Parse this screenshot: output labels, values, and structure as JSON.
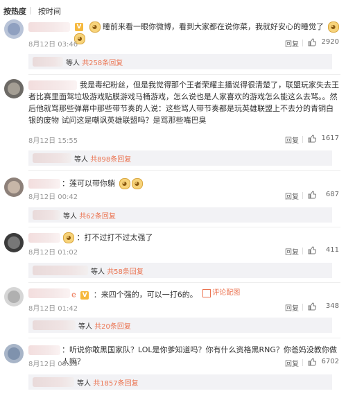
{
  "sort": {
    "hot": "按热度",
    "time": "按时间"
  },
  "comments": [
    {
      "text": "睡前来看一眼你微博，看到大家都在说你菜，我就好安心的睡觉了",
      "time": "8月12日 03:46",
      "reply_label": "回复",
      "likes": "2920",
      "sub": {
        "label": "等人",
        "link": "共258条回复"
      }
    },
    {
      "text": "我是毒纪粉丝，但是我觉得那个王者荣耀主播说得很清楚了，联盟玩家失去王者比赛里面驾垃圾游戏贴膜游戏马桶游戏，怎么说也是人家喜欢的游戏怎么能这么去骂。。然后他就骂那些弹幕中那些带节奏的人说：这些骂人带节奏都是玩英雄联盟上不去分的青铜白银的废物 试问这是嘲讽英雄联盟吗？是骂那些嘴巴臭",
      "time": "8月12日 15:55",
      "reply_label": "回复",
      "likes": "1617",
      "sub": {
        "label": "等人",
        "link": "共898条回复"
      }
    },
    {
      "text": "：莲可以带你躺",
      "time": "8月12日 00:42",
      "reply_label": "回复",
      "likes": "687",
      "sub": {
        "label": "等人",
        "link": "共62条回复"
      }
    },
    {
      "text": "：打不过打不过太强了",
      "time": "8月12日 01:02",
      "reply_label": "回复",
      "likes": "411",
      "sub": {
        "label": "等人",
        "link": "共58条回复"
      }
    },
    {
      "name_suffix": "e",
      "text": "：来四个强的，可以一打6的。",
      "evidence": "评论配图",
      "time": "8月12日 01:42",
      "reply_label": "回复",
      "likes": "348",
      "sub": {
        "label": "等人",
        "link": "共20条回复"
      }
    },
    {
      "text": "：听说你敢黑国家队？LOL是你爹知道吗？你有什么资格黑RNG？你爸妈没教你做人嘛？",
      "time": "8月12日 09:23",
      "reply_label": "回复",
      "likes": "6702",
      "sub": {
        "label": "等人",
        "link": "共1857条回复"
      }
    }
  ],
  "colors": {
    "accent": "#eb7350",
    "meta": "#999999",
    "subbg": "#f2f2f5"
  }
}
